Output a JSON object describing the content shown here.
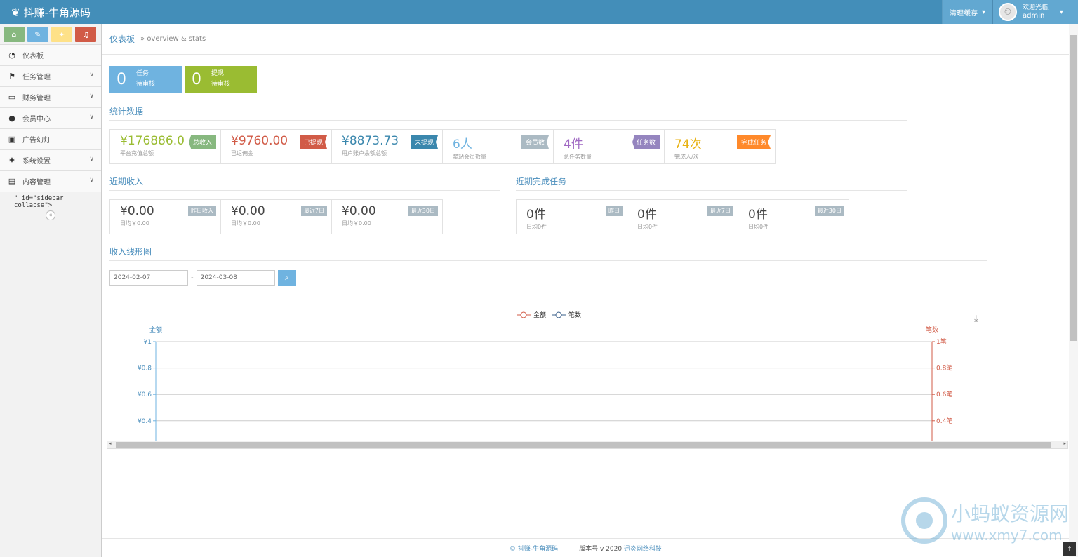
{
  "app": {
    "title": "抖赚-牛角源码"
  },
  "topbar": {
    "clear_cache": "清理缓存",
    "welcome": "欢迎光临,",
    "user": "admin"
  },
  "sidebar": {
    "items": [
      {
        "label": "仪表板",
        "icon": "dashboard-icon"
      },
      {
        "label": "任务管理",
        "icon": "flag-icon"
      },
      {
        "label": "财务管理",
        "icon": "wallet-icon"
      },
      {
        "label": "会员中心",
        "icon": "user-icon"
      },
      {
        "label": "广告幻灯",
        "icon": "picture-icon"
      },
      {
        "label": "系统设置",
        "icon": "gear-icon"
      },
      {
        "label": "内容管理",
        "icon": "book-icon"
      }
    ],
    "collapse_text": "\" id=\"sidebar collapse\">"
  },
  "breadcrumb": {
    "home": "仪表板",
    "sub": "» overview & stats"
  },
  "pending": [
    {
      "num": "0",
      "l1": "任务",
      "l2": "待审核"
    },
    {
      "num": "0",
      "l1": "提现",
      "l2": "待审核"
    }
  ],
  "sections": {
    "stats": "统计数据",
    "income": "近期收入",
    "tasks": "近期完成任务",
    "chart": "收入线形图"
  },
  "stats": [
    {
      "value": "¥176886.0",
      "desc": "平台充值总额",
      "tag": "总收入"
    },
    {
      "value": "¥9760.00",
      "desc": "已返佣金",
      "tag": "已提现"
    },
    {
      "value": "¥8873.73",
      "desc": "用户账户余额总额",
      "tag": "未提现"
    },
    {
      "value": "6人",
      "desc": "整站会员数量",
      "tag": "会员数"
    },
    {
      "value": "4件",
      "desc": "总任务数量",
      "tag": "任务数"
    },
    {
      "value": "74次",
      "desc": "完成人/次",
      "tag": "完成任务"
    }
  ],
  "income": [
    {
      "value": "¥0.00",
      "desc": "日均￥0.00",
      "tag": "昨日收入"
    },
    {
      "value": "¥0.00",
      "desc": "日均￥0.00",
      "tag": "最近7日"
    },
    {
      "value": "¥0.00",
      "desc": "日均￥0.00",
      "tag": "最近30日"
    }
  ],
  "tasks": [
    {
      "value": "0件",
      "desc": "日均0件",
      "tag": "昨日"
    },
    {
      "value": "0件",
      "desc": "日均0件",
      "tag": "最近7日"
    },
    {
      "value": "0件",
      "desc": "日均0件",
      "tag": "最近30日"
    }
  ],
  "dates": {
    "start": "2024-02-07",
    "end": "2024-03-08",
    "sep": "-"
  },
  "chart_data": {
    "type": "line",
    "legend": [
      "金额",
      "笔数"
    ],
    "ylabel": "金额",
    "y2label": "笔数",
    "yticks": [
      "¥1",
      "¥0.8",
      "¥0.6",
      "¥0.4"
    ],
    "y2ticks": [
      "1笔",
      "0.8笔",
      "0.6笔",
      "0.4笔"
    ],
    "ylim": [
      0,
      1
    ],
    "series": [
      {
        "name": "金额",
        "values": []
      },
      {
        "name": "笔数",
        "values": []
      }
    ]
  },
  "footer": {
    "copy": "© 抖赚-牛角源码",
    "version": "版本号 v 2020",
    "company": "迅炎网络科技"
  },
  "watermark": {
    "t1": "小蚂蚁资源网",
    "t2": "www.xmy7.com"
  },
  "colors": {
    "topbar": "#438eb9",
    "green": "#87b87f",
    "red": "#d15b47",
    "blue": "#3a87ad",
    "gray": "#abbac3",
    "purple": "#9585bf",
    "orange": "#ff892a"
  }
}
